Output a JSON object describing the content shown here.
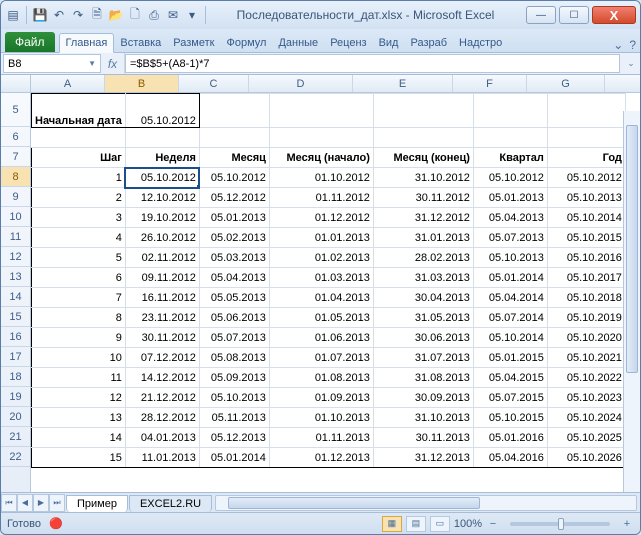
{
  "window": {
    "title": "Последовательности_дат.xlsx - Microsoft Excel"
  },
  "qat": {
    "save": "💾",
    "undo": "↶",
    "redo": "↷",
    "preview": "🗎",
    "open": "📂",
    "new": "🗋",
    "quick": "⎙",
    "mail": "✉"
  },
  "win_buttons": {
    "min": "—",
    "max": "☐",
    "close": "X"
  },
  "ribbon": {
    "file": "Файл",
    "tabs": [
      "Главная",
      "Вставка",
      "Разметк",
      "Формул",
      "Данные",
      "Реценз",
      "Вид",
      "Разраб",
      "Надстро"
    ],
    "minimize": "⌄",
    "help": "?"
  },
  "namebox": {
    "ref": "B8"
  },
  "fx_label": "fx",
  "formula": "=$B$5+(A8-1)*7",
  "columns": [
    "A",
    "B",
    "C",
    "D",
    "E",
    "F",
    "G"
  ],
  "row_numbers": [
    "5",
    "6",
    "7",
    "8",
    "9",
    "10",
    "11",
    "12",
    "13",
    "14",
    "15",
    "16",
    "17",
    "18",
    "19",
    "20",
    "21",
    "22"
  ],
  "header_label": "Начальная дата",
  "header_value": "05.10.2012",
  "col_headers": [
    "Шаг",
    "Неделя",
    "Месяц",
    "Месяц (начало)",
    "Месяц (конец)",
    "Квартал",
    "Год"
  ],
  "rows": [
    [
      "1",
      "05.10.2012",
      "05.10.2012",
      "01.10.2012",
      "31.10.2012",
      "05.10.2012",
      "05.10.2012"
    ],
    [
      "2",
      "12.10.2012",
      "05.12.2012",
      "01.11.2012",
      "30.11.2012",
      "05.01.2013",
      "05.10.2013"
    ],
    [
      "3",
      "19.10.2012",
      "05.01.2013",
      "01.12.2012",
      "31.12.2012",
      "05.04.2013",
      "05.10.2014"
    ],
    [
      "4",
      "26.10.2012",
      "05.02.2013",
      "01.01.2013",
      "31.01.2013",
      "05.07.2013",
      "05.10.2015"
    ],
    [
      "5",
      "02.11.2012",
      "05.03.2013",
      "01.02.2013",
      "28.02.2013",
      "05.10.2013",
      "05.10.2016"
    ],
    [
      "6",
      "09.11.2012",
      "05.04.2013",
      "01.03.2013",
      "31.03.2013",
      "05.01.2014",
      "05.10.2017"
    ],
    [
      "7",
      "16.11.2012",
      "05.05.2013",
      "01.04.2013",
      "30.04.2013",
      "05.04.2014",
      "05.10.2018"
    ],
    [
      "8",
      "23.11.2012",
      "05.06.2013",
      "01.05.2013",
      "31.05.2013",
      "05.07.2014",
      "05.10.2019"
    ],
    [
      "9",
      "30.11.2012",
      "05.07.2013",
      "01.06.2013",
      "30.06.2013",
      "05.10.2014",
      "05.10.2020"
    ],
    [
      "10",
      "07.12.2012",
      "05.08.2013",
      "01.07.2013",
      "31.07.2013",
      "05.01.2015",
      "05.10.2021"
    ],
    [
      "11",
      "14.12.2012",
      "05.09.2013",
      "01.08.2013",
      "31.08.2013",
      "05.04.2015",
      "05.10.2022"
    ],
    [
      "12",
      "21.12.2012",
      "05.10.2013",
      "01.09.2013",
      "30.09.2013",
      "05.07.2015",
      "05.10.2023"
    ],
    [
      "13",
      "28.12.2012",
      "05.11.2013",
      "01.10.2013",
      "31.10.2013",
      "05.10.2015",
      "05.10.2024"
    ],
    [
      "14",
      "04.01.2013",
      "05.12.2013",
      "01.11.2013",
      "30.11.2013",
      "05.01.2016",
      "05.10.2025"
    ],
    [
      "15",
      "11.01.2013",
      "05.01.2014",
      "01.12.2013",
      "31.12.2013",
      "05.04.2016",
      "05.10.2026"
    ]
  ],
  "sheet_tabs": {
    "active": "Пример",
    "other": "EXCEL2.RU"
  },
  "status": {
    "ready": "Готово",
    "rec": "🔴",
    "zoom": "100%",
    "minus": "−",
    "plus": "+"
  }
}
